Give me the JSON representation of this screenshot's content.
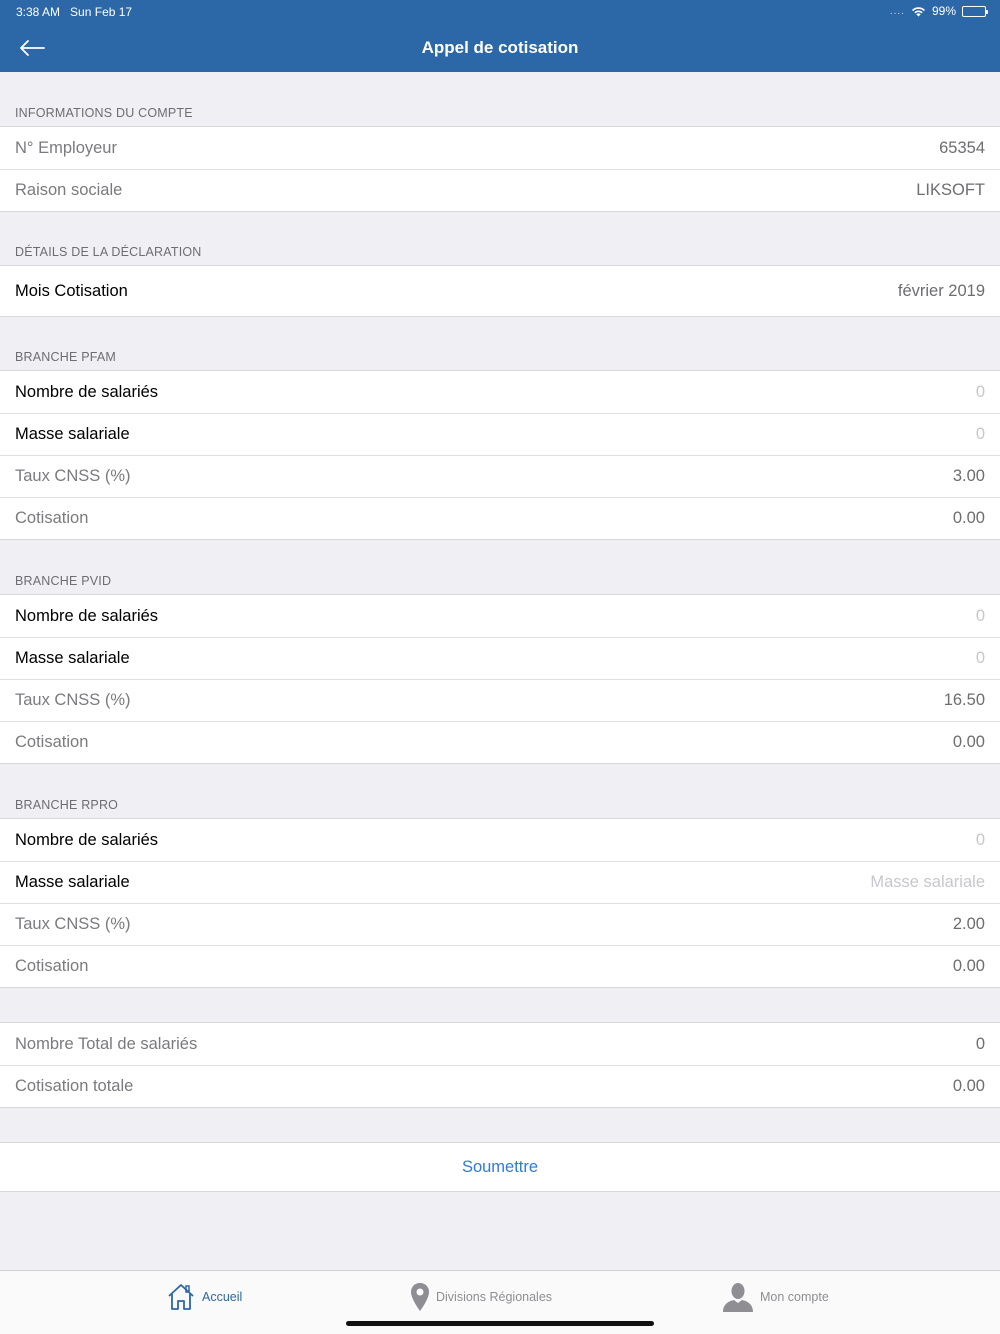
{
  "status_bar": {
    "time": "3:38 AM",
    "date": "Sun Feb 17",
    "battery": "99%",
    "signal_dots": "....",
    "wifi_icon": "wifi-icon"
  },
  "nav": {
    "title": "Appel de cotisation",
    "back_icon": "arrow-left-icon"
  },
  "account": {
    "header": "INFORMATIONS DU COMPTE",
    "employer_label": "N° Employeur",
    "employer_value": "65354",
    "company_label": "Raison sociale",
    "company_value": "LIKSOFT"
  },
  "declaration": {
    "header": "DÉTAILS DE LA DÉCLARATION",
    "month_label": "Mois Cotisation",
    "month_value": "février 2019"
  },
  "pfam": {
    "header": "BRANCHE PFAM",
    "employees_label": "Nombre de salariés",
    "employees_placeholder": "0",
    "payroll_label": "Masse salariale",
    "payroll_placeholder": "0",
    "rate_label": "Taux CNSS (%)",
    "rate_value": "3.00",
    "contribution_label": "Cotisation",
    "contribution_value": "0.00"
  },
  "pvid": {
    "header": "BRANCHE PVID",
    "employees_label": "Nombre de salariés",
    "employees_placeholder": "0",
    "payroll_label": "Masse salariale",
    "payroll_placeholder": "0",
    "rate_label": "Taux CNSS (%)",
    "rate_value": "16.50",
    "contribution_label": "Cotisation",
    "contribution_value": "0.00"
  },
  "rpro": {
    "header": "BRANCHE RPRO",
    "employees_label": "Nombre de salariés",
    "employees_placeholder": "0",
    "payroll_label": "Masse salariale",
    "payroll_placeholder": "Masse salariale",
    "rate_label": "Taux CNSS (%)",
    "rate_value": "2.00",
    "contribution_label": "Cotisation",
    "contribution_value": "0.00"
  },
  "totals": {
    "employees_label": "Nombre Total de salariés",
    "employees_value": "0",
    "contribution_label": "Cotisation totale",
    "contribution_value": "0.00"
  },
  "submit_label": "Soumettre",
  "tabs": [
    {
      "label": "Accueil",
      "icon": "home-icon",
      "active": true
    },
    {
      "label": "Divisions Régionales",
      "icon": "map-pin-icon",
      "active": false
    },
    {
      "label": "Mon compte",
      "icon": "user-icon",
      "active": false
    }
  ],
  "colors": {
    "primary": "#2c68a8",
    "link": "#2f7bd8",
    "background": "#efeff4",
    "battery": "#4cd964"
  }
}
